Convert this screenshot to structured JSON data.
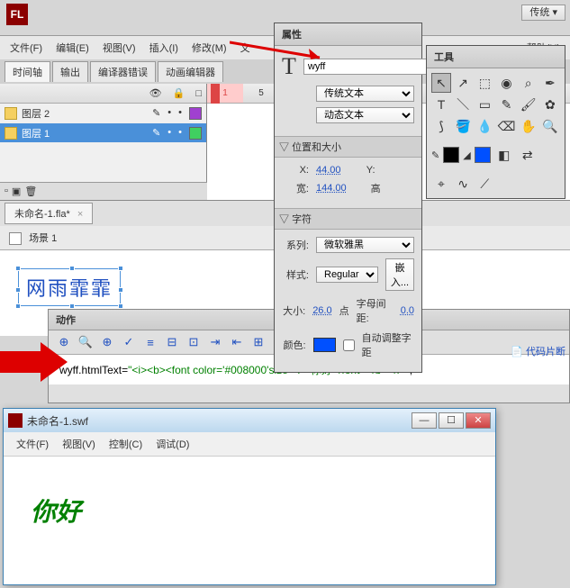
{
  "topbar": {
    "logo": "FL",
    "layout_mode": "传统",
    "help_menu": "帮助(H)"
  },
  "menu": {
    "file": "文件(F)",
    "edit": "编辑(E)",
    "view": "视图(V)",
    "insert": "插入(I)",
    "modify": "修改(M)",
    "text": "文",
    "debug": "调试(D)",
    "control": "控制(C)"
  },
  "tabs": {
    "timeline": "时间轴",
    "output": "输出",
    "compiler_errors": "编译器错误",
    "animation_editor": "动画编辑器"
  },
  "layers": {
    "layer2": "图层 2",
    "layer1": "图层 1"
  },
  "frame_numbers": [
    "1",
    "5"
  ],
  "document": {
    "tab_name": "未命名-1.fla*",
    "scene": "场景 1"
  },
  "stage": {
    "text_content": "网雨霏霏"
  },
  "properties": {
    "panel_title": "属性",
    "instance_name": "wyff",
    "text_type_classic": "传统文本",
    "text_type_dynamic": "动态文本",
    "section_pos_size": "位置和大小",
    "x_label": "X:",
    "x_value": "44.00",
    "y_label": "Y:",
    "width_label": "宽:",
    "width_value": "144.00",
    "height_label": "高",
    "section_char": "字符",
    "family_label": "系列:",
    "family_value": "微软雅黑",
    "style_label": "样式:",
    "style_value": "Regular",
    "embed_btn": "嵌入...",
    "size_label": "大小:",
    "size_value": "26.0",
    "size_unit": "点",
    "spacing_label": "字母间距:",
    "spacing_value": "0.0",
    "color_label": "颜色:",
    "auto_adjust": "自动调整字距"
  },
  "tools": {
    "panel_title": "工具"
  },
  "actions": {
    "panel_title": "动作",
    "code_prefix": "wyff.htmlText=",
    "code_string": "\"<i><b><font color='#008000'size='7'>你好</font></b></i>\"",
    "code_helper": "代码片断"
  },
  "swf": {
    "title": "未命名-1.swf",
    "content_text": "你好"
  }
}
